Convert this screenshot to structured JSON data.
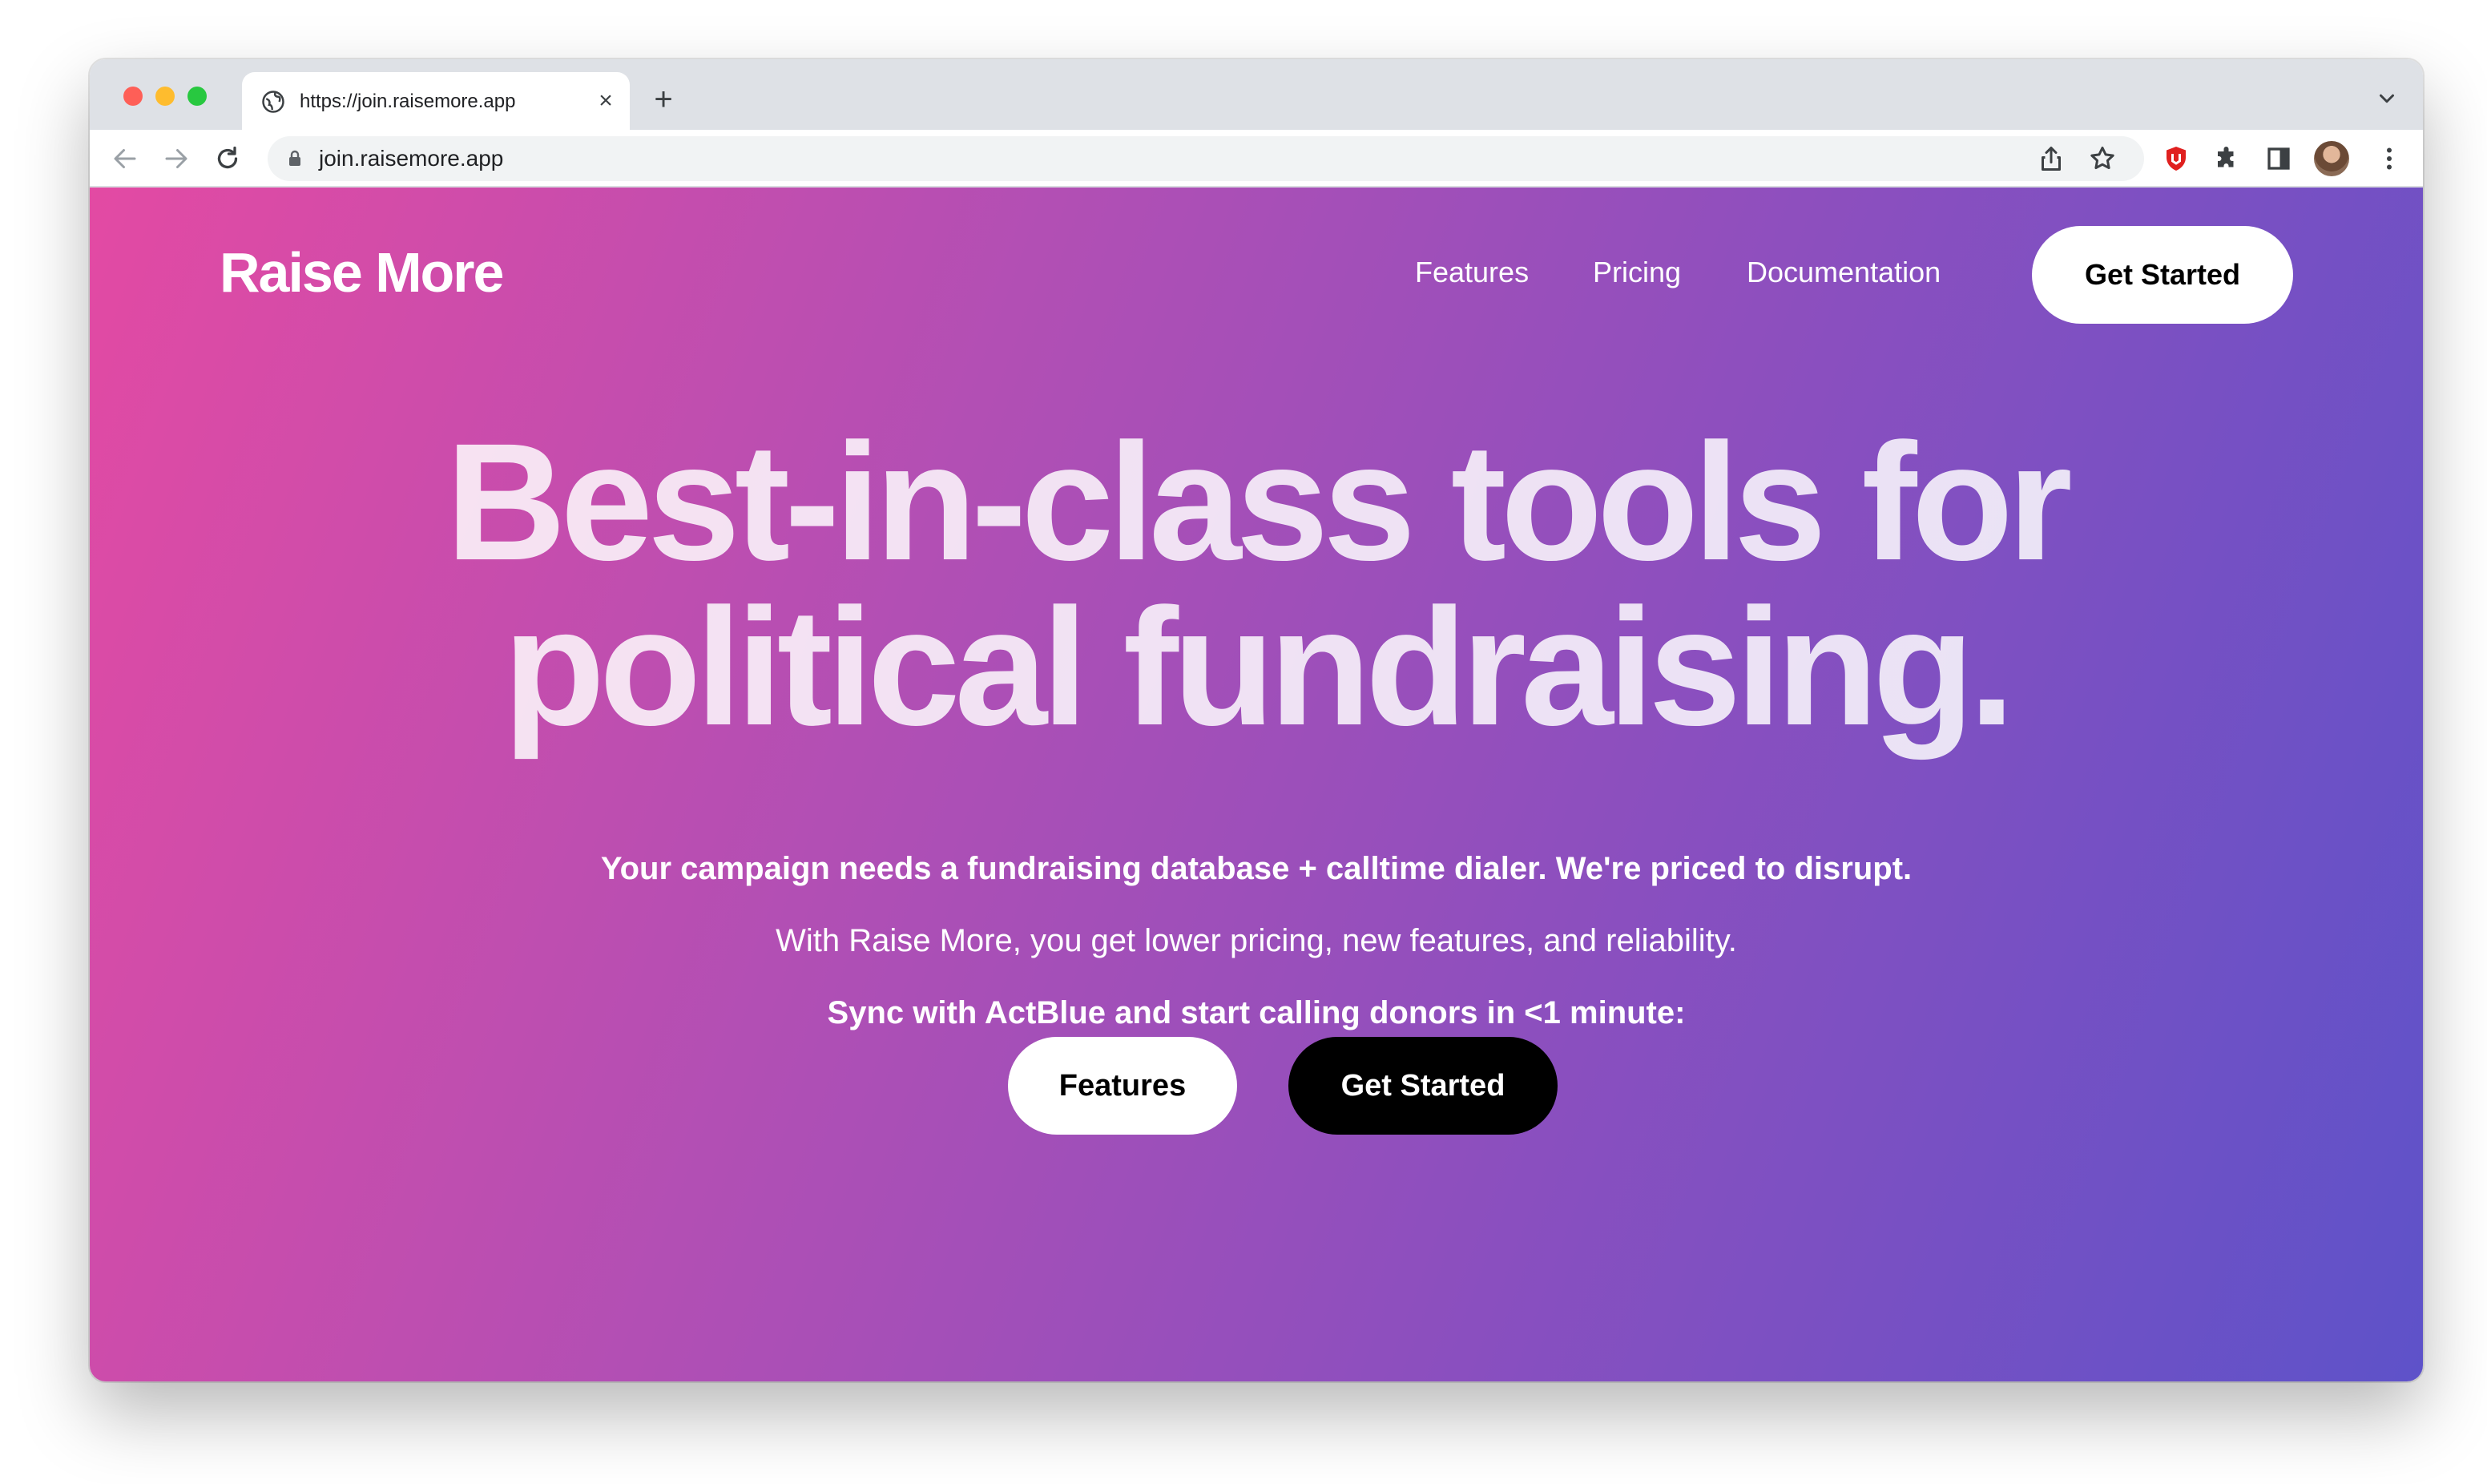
{
  "browser": {
    "tab": {
      "title": "https://join.raisemore.app",
      "icon": "globe-icon",
      "close_label": "×"
    },
    "new_tab_label": "+",
    "address": "join.raisemore.app",
    "toolbar_icons": [
      "back-arrow-icon",
      "forward-arrow-icon",
      "reload-icon",
      "lock-icon",
      "share-icon",
      "bookmark-star-icon",
      "extension-shield-icon",
      "puzzle-icon",
      "side-panel-icon",
      "profile-avatar",
      "kebab-menu-icon"
    ]
  },
  "site": {
    "brand": "Raise More",
    "nav": {
      "links": [
        "Features",
        "Pricing",
        "Documentation"
      ],
      "cta": "Get Started"
    },
    "hero": {
      "headline_line1": "Best-in-class tools for",
      "headline_line2": "political fundraising.",
      "subhead": "Your campaign needs a fundraising database + calltime dialer. We're priced to disrupt.",
      "body": "With Raise More, you get lower pricing, new features, and reliability.",
      "sync": "Sync with ActBlue and start calling donors in <1 minute:",
      "buttons": {
        "primary": "Features",
        "secondary": "Get Started"
      }
    }
  },
  "colors": {
    "gradient_start": "#e34aa3",
    "gradient_end": "#5e52c9",
    "cta_dark": "#000000",
    "cta_light": "#ffffff"
  }
}
